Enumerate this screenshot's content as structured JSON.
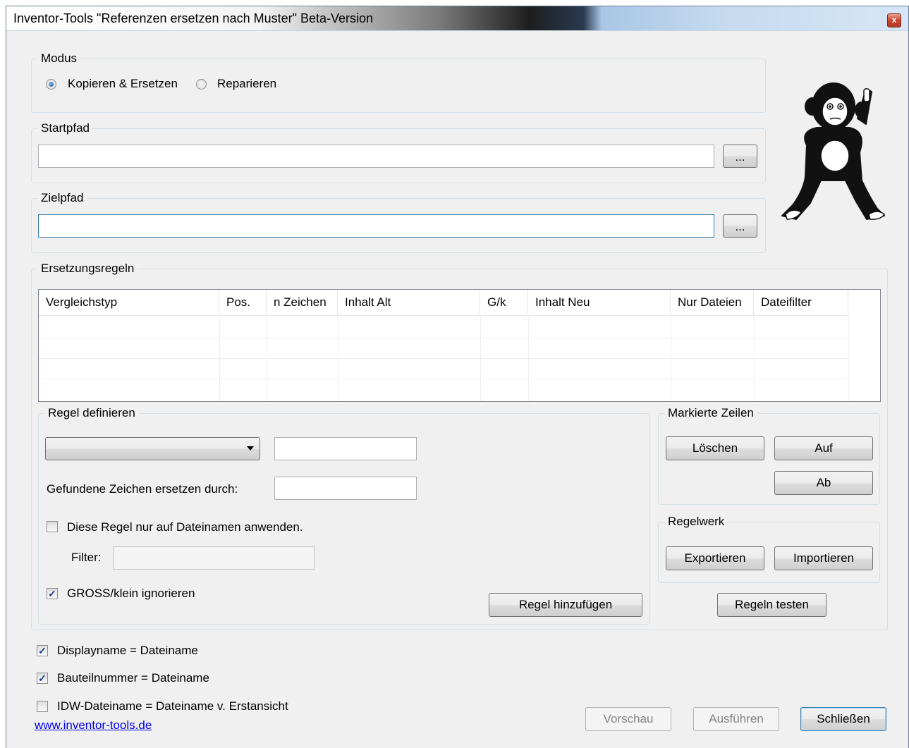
{
  "window": {
    "title": "Inventor-Tools \"Referenzen ersetzen nach Muster\" Beta-Version",
    "close_glyph": "x"
  },
  "modus": {
    "legend": "Modus",
    "option_copy": "Kopieren & Ersetzen",
    "option_repair": "Reparieren",
    "selected": "Kopieren & Ersetzen"
  },
  "startpfad": {
    "legend": "Startpfad",
    "value": "",
    "browse_label": "..."
  },
  "zielpfad": {
    "legend": "Zielpfad",
    "value": "",
    "browse_label": "..."
  },
  "rules": {
    "legend": "Ersetzungsregeln",
    "columns": [
      "Vergleichstyp",
      "Pos.",
      "n Zeichen",
      "Inhalt Alt",
      "G/k",
      "Inhalt Neu",
      "Nur Dateien",
      "Dateifilter"
    ],
    "rows": []
  },
  "define": {
    "legend": "Regel definieren",
    "compare_type": "",
    "search_value": "",
    "replace_label": "Gefundene Zeichen ersetzen durch:",
    "replace_value": "",
    "filenames_only_label": "Diese Regel nur auf Dateinamen anwenden.",
    "filenames_only": false,
    "filter_label": "Filter:",
    "filter_value": "",
    "ignore_case_label": "GROSS/klein ignorieren",
    "ignore_case": true,
    "add_button": "Regel hinzufügen"
  },
  "marked_rows": {
    "legend": "Markierte Zeilen",
    "delete": "Löschen",
    "up": "Auf",
    "down": "Ab"
  },
  "ruleset": {
    "legend": "Regelwerk",
    "export": "Exportieren",
    "import": "Importieren"
  },
  "test_button": "Regeln testen",
  "options": {
    "displayname_label": "Displayname = Dateiname",
    "displayname": true,
    "partnumber_label": "Bauteilnummer = Dateiname",
    "partnumber": true,
    "idw_label": "IDW-Dateiname = Dateiname v. Erstansicht",
    "idw": false
  },
  "footer": {
    "link": "www.inventor-tools.de",
    "preview": "Vorschau",
    "execute": "Ausführen",
    "close": "Schließen"
  },
  "icons": {
    "logo": "monkey-thinking-logo",
    "check": "✓",
    "dropdown": "chevron-down-icon"
  }
}
